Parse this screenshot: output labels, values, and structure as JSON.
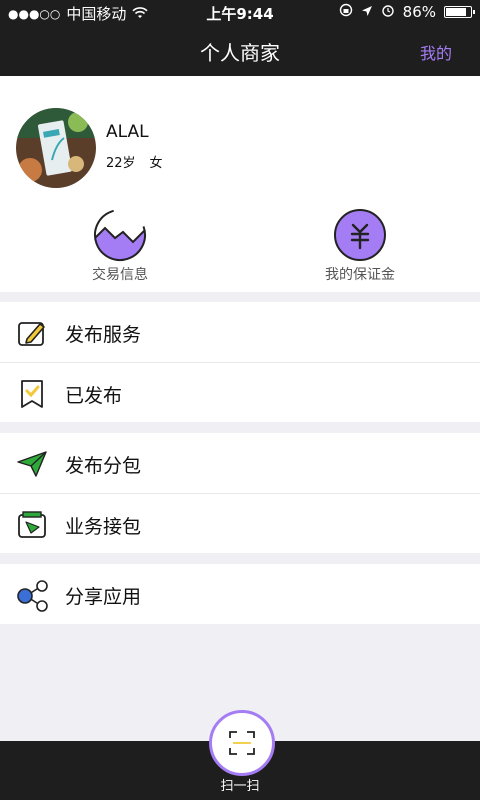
{
  "status_bar": {
    "signal_dots": "●●●○○",
    "carrier": "中国移动",
    "time": "上午9:44",
    "battery": "86%",
    "battery_level": 0.86
  },
  "nav": {
    "title": "个人商家",
    "right_link": "我的"
  },
  "profile": {
    "name": "ALAL",
    "age": "22岁",
    "gender": "女"
  },
  "quick_actions": [
    {
      "label": "交易信息",
      "icon": "wave-circle-icon"
    },
    {
      "label": "我的保证金",
      "icon": "yuan-coin-icon"
    }
  ],
  "menu_groups": [
    [
      {
        "label": "发布服务",
        "icon": "pencil-icon"
      },
      {
        "label": "已发布",
        "icon": "check-bookmark-icon"
      }
    ],
    [
      {
        "label": "发布分包",
        "icon": "paper-plane-icon"
      },
      {
        "label": "业务接包",
        "icon": "inbox-plane-icon"
      }
    ],
    [
      {
        "label": "分享应用",
        "icon": "share-nodes-icon"
      }
    ]
  ],
  "bottom": {
    "scan_label": "扫一扫"
  },
  "colors": {
    "accent": "#a47cf3",
    "bar": "#1e1e1e",
    "background": "#efeff4",
    "green": "#2eaa3a",
    "yellow": "#f3c93a"
  }
}
